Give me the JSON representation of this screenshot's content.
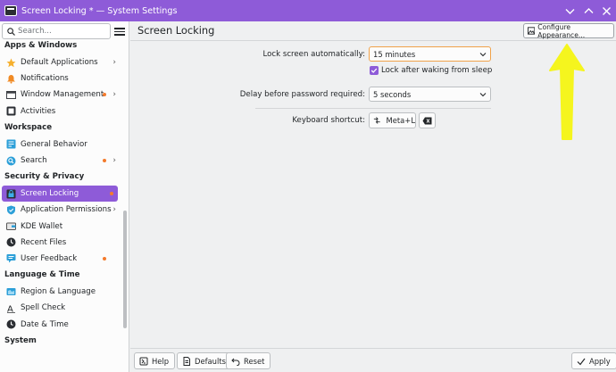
{
  "window": {
    "title": "Screen Locking * — System Settings"
  },
  "search": {
    "placeholder": "Search..."
  },
  "sidebar": {
    "sections": [
      {
        "label": "Apps & Windows",
        "items": [
          {
            "label": "Default Applications",
            "icon": "star-icon",
            "chevron": true
          },
          {
            "label": "Notifications",
            "icon": "bell-icon"
          },
          {
            "label": "Window Management",
            "icon": "window-icon",
            "dot": true,
            "chevron": true
          },
          {
            "label": "Activities",
            "icon": "activities-icon"
          }
        ]
      },
      {
        "label": "Workspace",
        "items": [
          {
            "label": "General Behavior",
            "icon": "general-behavior-icon"
          },
          {
            "label": "Search",
            "icon": "search-icon",
            "dot": true,
            "chevron": true
          }
        ]
      },
      {
        "label": "Security & Privacy",
        "items": [
          {
            "label": "Screen Locking",
            "icon": "screen-lock-icon",
            "active": true,
            "dot": true
          },
          {
            "label": "Application Permissions",
            "icon": "shield-icon",
            "chevron": true
          },
          {
            "label": "KDE Wallet",
            "icon": "wallet-icon"
          },
          {
            "label": "Recent Files",
            "icon": "recent-files-icon"
          },
          {
            "label": "User Feedback",
            "icon": "feedback-icon",
            "dot": true
          }
        ]
      },
      {
        "label": "Language & Time",
        "items": [
          {
            "label": "Region & Language",
            "icon": "region-icon"
          },
          {
            "label": "Spell Check",
            "icon": "spell-check-icon"
          },
          {
            "label": "Date & Time",
            "icon": "clock-icon"
          }
        ]
      },
      {
        "label": "System",
        "items": []
      }
    ]
  },
  "page": {
    "title": "Screen Locking",
    "configure_label": "Configure Appearance...",
    "lock_auto_label": "Lock screen automatically:",
    "lock_auto_value": "15 minutes",
    "lock_after_wake_label": "Lock after waking from sleep",
    "lock_after_wake_checked": true,
    "delay_label": "Delay before password required:",
    "delay_value": "5 seconds",
    "shortcut_label": "Keyboard shortcut:",
    "shortcut_value": "Meta+L"
  },
  "footer": {
    "help": "Help",
    "defaults": "Defaults",
    "reset": "Reset",
    "apply": "Apply"
  },
  "colors": {
    "accent": "#8e5bd8",
    "notification_dot": "#f47a2c",
    "annotation_arrow": "#f5f51e"
  }
}
